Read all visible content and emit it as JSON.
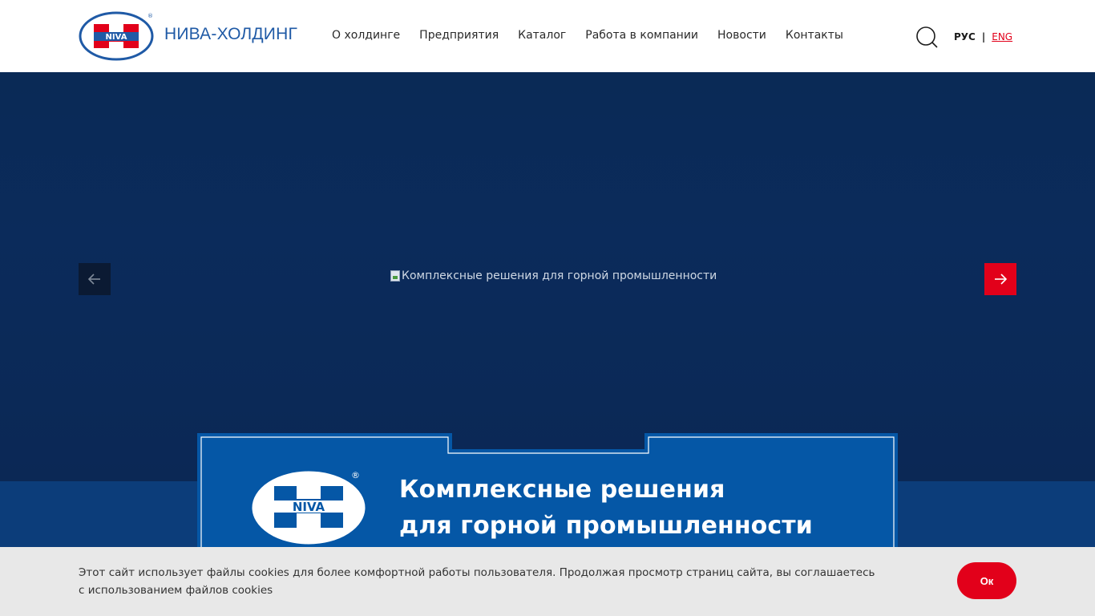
{
  "header": {
    "brand": "НИВА-ХОЛДИНГ",
    "logo_text": "NIVA",
    "nav": [
      {
        "label": "О холдинге"
      },
      {
        "label": "Предприятия"
      },
      {
        "label": "Каталог"
      },
      {
        "label": "Работа в компании"
      },
      {
        "label": "Новости"
      },
      {
        "label": "Контакты"
      }
    ],
    "search_icon": "search-icon",
    "lang": {
      "ru": "РУС",
      "sep": "|",
      "en": "ENG"
    }
  },
  "hero": {
    "image_alt": "Комплексные решения для горной промышленности",
    "prev_icon": "arrow-left-icon",
    "next_icon": "arrow-right-icon"
  },
  "banner": {
    "logo_text": "NIVA",
    "title_line1": "Комплексные решения",
    "title_line2": "для горной промышленности"
  },
  "cookie": {
    "text": "Этот сайт использует файлы cookies для более комфортной работы пользователя. Продолжая просмотр страниц сайта, вы соглашаетесь с использованием файлов cookies",
    "ok_label": "Ок"
  },
  "colors": {
    "brand_blue": "#1f5aa6",
    "accent_red": "#e2001a",
    "hero_dark": "#0b2b5b",
    "banner_blue": "#0557a6"
  }
}
